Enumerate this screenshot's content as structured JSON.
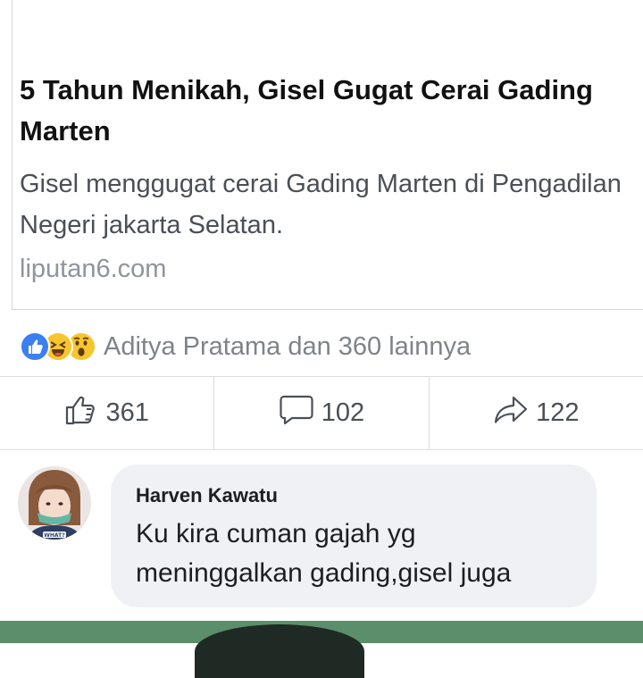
{
  "link_preview": {
    "title": "5 Tahun Menikah, Gisel Gugat Cerai Gading Marten",
    "description": "Gisel menggugat cerai Gading Marten di Pengadilan Negeri jakarta Selatan.",
    "domain": "liputan6.com"
  },
  "reactions": {
    "icons": [
      "like-icon",
      "haha-icon",
      "wow-icon"
    ],
    "summary": "Aditya Pratama dan 360 lainnya"
  },
  "actions": {
    "like_count": "361",
    "comment_count": "102",
    "share_count": "122"
  },
  "comment": {
    "author": "Harven Kawatu",
    "text": "Ku kira cuman gajah yg meninggalkan gading,gisel juga",
    "avatar_badge": "WHAT?"
  },
  "colors": {
    "like_blue": "#3b7ff0",
    "reaction_yellow": "#f7c52e",
    "bubble_bg": "#f0f1f4",
    "strip_green": "#5b8e6a"
  }
}
